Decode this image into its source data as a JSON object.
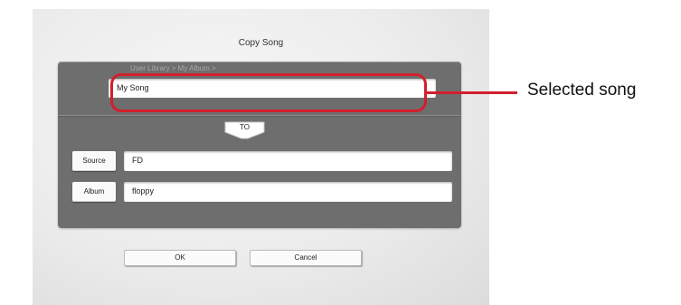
{
  "dialog": {
    "title": "Copy Song",
    "breadcrumb": "User Library > My Album >",
    "selected_song": "My Song",
    "to_label": "TO",
    "source_label": "Source",
    "source_value": "FD",
    "album_label": "Album",
    "album_value": "floppy",
    "ok_label": "OK",
    "cancel_label": "Cancel"
  },
  "annotation": {
    "callout_text": "Selected song",
    "highlight_color": "#d21f2c"
  }
}
